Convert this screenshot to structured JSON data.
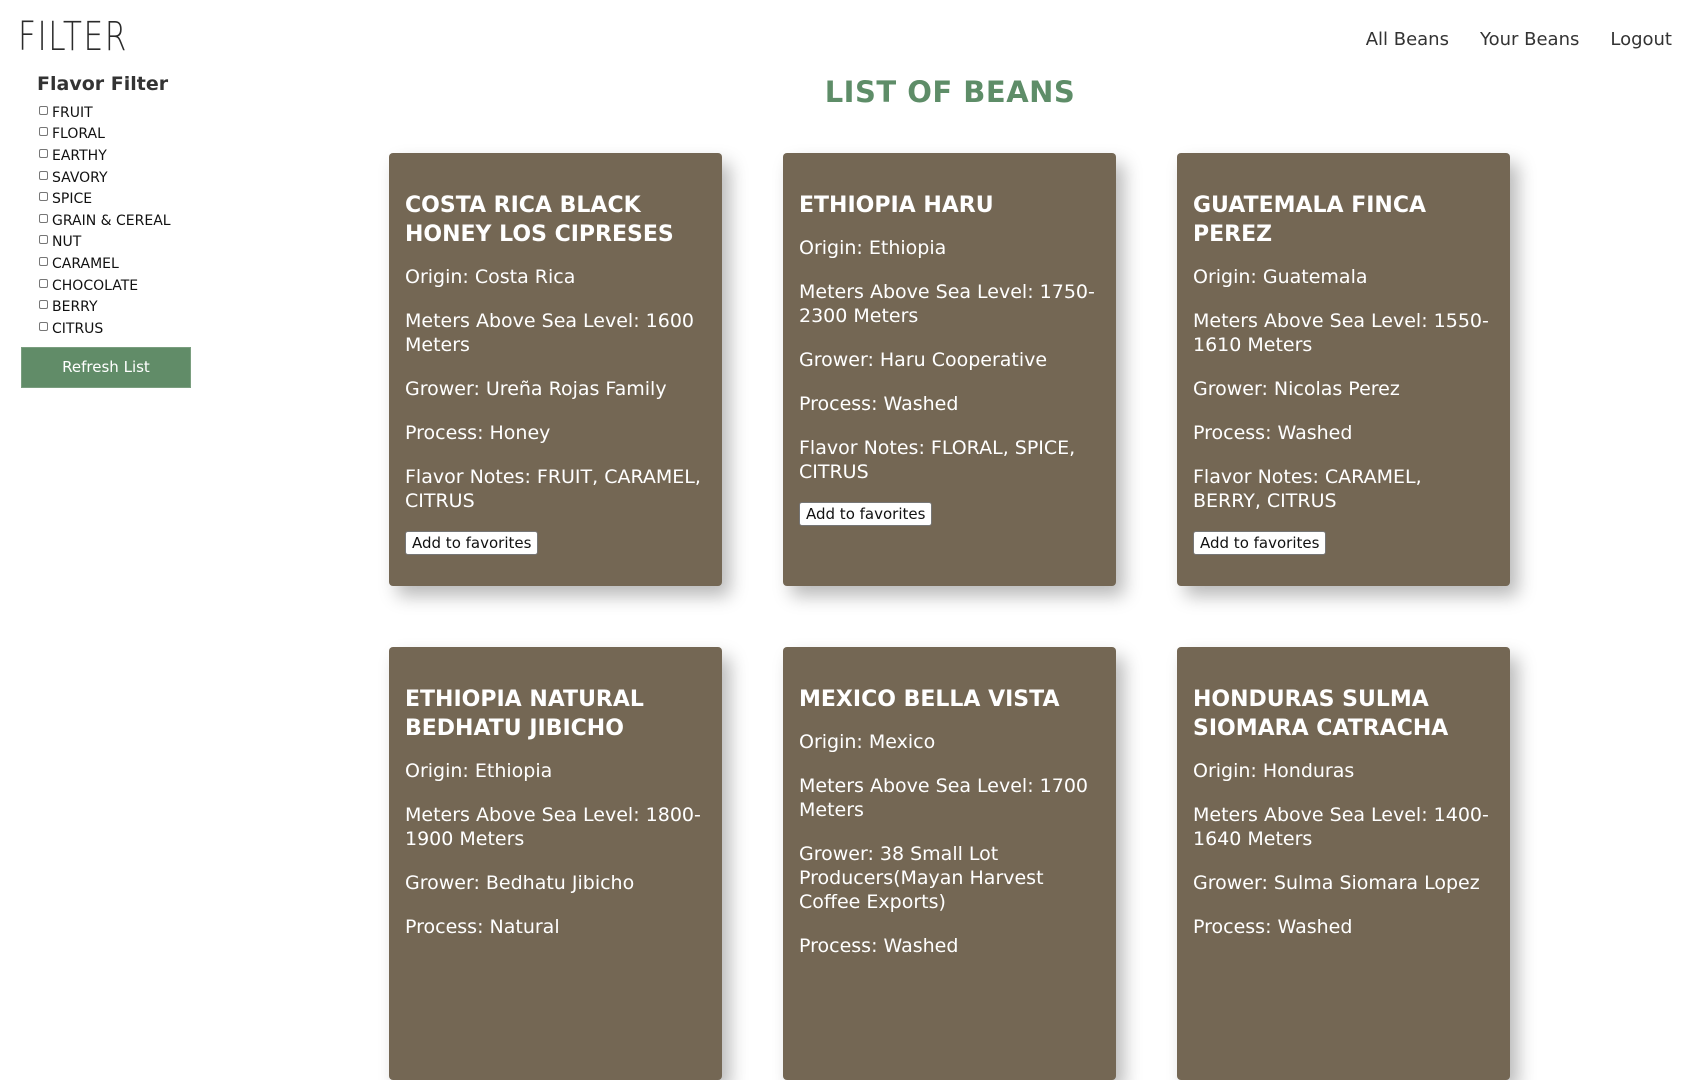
{
  "header": {
    "logo": "FILTER",
    "nav": [
      "All Beans",
      "Your Beans",
      "Logout"
    ]
  },
  "sidebar": {
    "title": "Flavor Filter",
    "flavors": [
      "FRUIT",
      "FLORAL",
      "EARTHY",
      "SAVORY",
      "SPICE",
      "GRAIN & CEREAL",
      "NUT",
      "CARAMEL",
      "CHOCOLATE",
      "BERRY",
      "CITRUS"
    ],
    "refresh_label": "Refresh List"
  },
  "main": {
    "title": "LIST OF BEANS",
    "beans": [
      {
        "name": "COSTA RICA BLACK HONEY LOS CIPRESES",
        "origin": "Origin: Costa Rica",
        "masl": "Meters Above Sea Level: 1600 Meters",
        "grower": "Grower: Ureña Rojas Family",
        "process": "Process: Honey",
        "flavors": "Flavor Notes: FRUIT, CARAMEL, CITRUS",
        "button": "Add to favorites"
      },
      {
        "name": "ETHIOPIA HARU",
        "origin": "Origin: Ethiopia",
        "masl": "Meters Above Sea Level: 1750-2300 Meters",
        "grower": "Grower: Haru Cooperative",
        "process": "Process: Washed",
        "flavors": "Flavor Notes: FLORAL, SPICE, CITRUS",
        "button": "Add to favorites"
      },
      {
        "name": "GUATEMALA FINCA PEREZ",
        "origin": "Origin: Guatemala",
        "masl": "Meters Above Sea Level: 1550-1610 Meters",
        "grower": "Grower: Nicolas Perez",
        "process": "Process: Washed",
        "flavors": "Flavor Notes: CARAMEL, BERRY, CITRUS",
        "button": "Add to favorites"
      },
      {
        "name": "ETHIOPIA NATURAL BEDHATU JIBICHO",
        "origin": "Origin: Ethiopia",
        "masl": "Meters Above Sea Level: 1800-1900 Meters",
        "grower": "Grower: Bedhatu Jibicho",
        "process": "Process: Natural"
      },
      {
        "name": "MEXICO BELLA VISTA",
        "origin": "Origin: Mexico",
        "masl": "Meters Above Sea Level: 1700 Meters",
        "grower": "Grower: 38 Small Lot Producers(Mayan Harvest Coffee Exports)",
        "process": "Process: Washed"
      },
      {
        "name": "HONDURAS SULMA SIOMARA CATRACHA",
        "origin": "Origin: Honduras",
        "masl": "Meters Above Sea Level: 1400-1640 Meters",
        "grower": "Grower: Sulma Siomara Lopez",
        "process": "Process: Washed"
      }
    ]
  },
  "colors": {
    "card_bg": "#746754",
    "accent_green": "#618c68",
    "title_green": "#5e8d68"
  }
}
